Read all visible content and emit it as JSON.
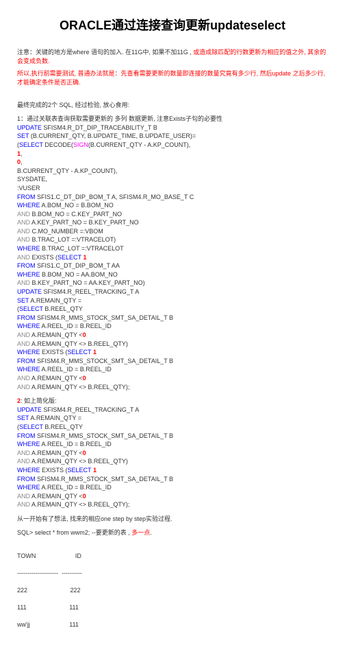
{
  "title": "ORACLE通过连接查询更新updateselect",
  "note1_prefix": "注意：关键的地方是where 语句的加入. 在11G中, 如果不加11G , ",
  "note1_red": "或造成除匹配的行数更新为相应的值之外, 其余的会变成负数.",
  "note2": "所以,执行前需要测试, 普通办法就是：先查看需要更新的数量即连接的数量究竟有多少行, 然后update 之后多少行, 才能确定条件是否正确.",
  "section1_title": "最终完成的2个 SQL, 经过检验, 放心食用:",
  "section1_sub": "1：通过关联表查询获取需要更新的 多列 数据更新, 注意Exists子句的必要性",
  "l1": "UPDATE",
  "l1b": " SFISM4.R_DT_DIP_TRACEABILITY_T B",
  "l2": "SET",
  "l2b": " (B.CURRENT_QTY, B.UPDATE_TIME, B.UPDATE_USER)=",
  "l3": "(",
  "l3b": "SELECT",
  "l3c": " DECODE(",
  "l3d": "SIGN",
  "l3e": "(B.CURRENT_QTY - A.KP_COUNT),",
  "l4": "1",
  "l4b": ",",
  "l5": "0",
  "l5b": ",",
  "l6": "B.CURRENT_QTY - A.KP_COUNT),",
  "l7": "SYSDATE,",
  "l8": ":VUSER",
  "l9": "FROM",
  "l9b": " SFIS1.C_DT_DIP_BOM_T A, SFISM4.R_MO_BASE_T C",
  "l10": "WHERE",
  "l10b": " A.BOM_NO = B.BOM_NO",
  "l11": "AND",
  "l11b": " B.BOM_NO = C.KEY_PART_NO",
  "l12": "AND",
  "l12b": " A.KEY_PART_NO = B.KEY_PART_NO",
  "l13": "AND",
  "l13b": " C.MO_NUMBER =:VBOM",
  "l14": "AND",
  "l14b": " B.TRAC_LOT =:VTRACELOT)",
  "l15": "WHERE",
  "l15b": " B.TRAC_LOT =:VTRACELOT",
  "l16": "AND",
  "l16b": " EXISTS (",
  "l16c": "SELECT",
  "l16d": " 1",
  "l17": "FROM",
  "l17b": " SFIS1.C_DT_DIP_BOM_T AA",
  "l18": "WHERE",
  "l18b": " B.BOM_NO = AA.BOM_NO",
  "l19": "AND",
  "l19b": " B.KEY_PART_NO = AA.KEY_PART_NO)",
  "l20": "UPDATE",
  "l20b": " SFISM4.R_REEL_TRACKING_T A",
  "l21": "SET",
  "l21b": " A.REMAIN_QTY =",
  "l22": "(",
  "l22b": "SELECT",
  "l22c": " B.REEL_QTY",
  "l23": "FROM",
  "l23b": " SFISM4.R_MMS_STOCK_SMT_SA_DETAIL_T B",
  "l24": "WHERE",
  "l24b": " A.REEL_ID = B.REEL_ID",
  "l25": "AND",
  "l25b": " A.REMAIN_QTY <",
  "l25c": "0",
  "l26": "AND",
  "l26b": " A.REMAIN_QTY <> B.REEL_QTY)",
  "l27": "WHERE",
  "l27b": " EXISTS (",
  "l27c": "SELECT",
  "l27d": " 1",
  "l28": "FROM",
  "l28b": " SFISM4.R_MMS_STOCK_SMT_SA_DETAIL_T B",
  "l29": "WHERE",
  "l29b": " A.REEL_ID = B.REEL_ID",
  "l30": "AND",
  "l30b": " A.REMAIN_QTY <",
  "l30c": "0",
  "l31": "AND",
  "l31b": " A.REMAIN_QTY <> B.REEL_QTY);",
  "section2_label": "2",
  "section2_text": ": 如上简化版:",
  "m1": "UPDATE",
  "m1b": " SFISM4.R_REEL_TRACKING_T A",
  "m2": "SET",
  "m2b": " A.REMAIN_QTY =",
  "m3": "(",
  "m3b": "SELECT",
  "m3c": " B.REEL_QTY",
  "m4": "FROM",
  "m4b": " SFISM4.R_MMS_STOCK_SMT_SA_DETAIL_T B",
  "m5": "WHERE",
  "m5b": " A.REEL_ID = B.REEL_ID",
  "m6": "AND",
  "m6b": " A.REMAIN_QTY <",
  "m6c": "0",
  "m7": "AND",
  "m7b": " A.REMAIN_QTY <> B.REEL_QTY)",
  "m8": "WHERE",
  "m8b": " EXISTS (",
  "m8c": "SELECT",
  "m8d": " 1",
  "m9": "FROM",
  "m9b": " SFISM4.R_MMS_STOCK_SMT_SA_DETAIL_T B",
  "m10": "WHERE",
  "m10b": " A.REEL_ID = B.REEL_ID",
  "m11": "AND",
  "m11b": " A.REMAIN_QTY <",
  "m11c": "0",
  "m12": "AND",
  "m12b": " A.REMAIN_QTY <> B.REEL_QTY);",
  "section3": "从一开始有了想法, 找来的相应one step by step实验过程.",
  "sql_line_prefix": "SQL> select * from wwm2;       --要更新的表 , ",
  "sql_line_red": "多一点",
  "sql_line_end": ".",
  "table_header": "TOWN                       ID",
  "table_sep": "--------------------  ----------",
  "table_r1": "222                         222",
  "table_r2": "111                         111",
  "table_r3": "ww'jj                       111"
}
